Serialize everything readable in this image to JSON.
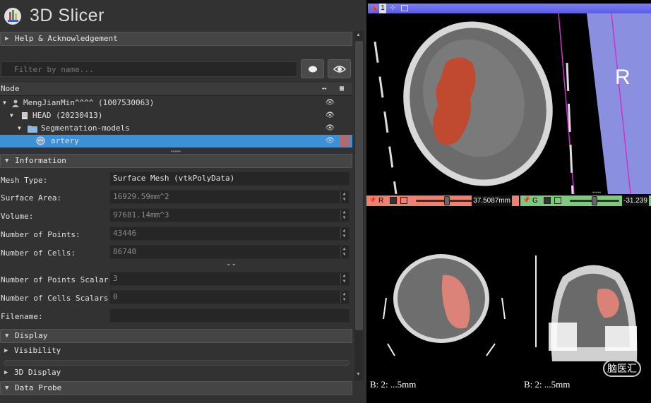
{
  "app": {
    "title": "3D Slicer",
    "logo_icon": "slicer-logo-icon"
  },
  "sections": {
    "help": "Help & Acknowledgement",
    "information": "Information",
    "display": "Display",
    "visibility": "Visibility",
    "display3d": "3D Display",
    "data_probe": "Data Probe"
  },
  "filter": {
    "placeholder": "Filter by name..."
  },
  "tree": {
    "header_node": "Node",
    "rows": [
      {
        "label": "MengJianMin^^^^ (1007530063)",
        "icon": "patient-icon"
      },
      {
        "label": "HEAD (20230413)",
        "icon": "study-icon"
      },
      {
        "label": "Segmentation-models",
        "icon": "folder-icon"
      },
      {
        "label": "artery",
        "icon": "model-icon",
        "color": "#b06a70"
      }
    ]
  },
  "info": {
    "mesh_type": {
      "label": "Mesh Type:",
      "value": "Surface Mesh (vtkPolyData)"
    },
    "surface_area": {
      "label": "Surface Area:",
      "value": "16929.59mm^2"
    },
    "volume": {
      "label": "Volume:",
      "value": "97681.14mm^3"
    },
    "num_points": {
      "label": "Number of Points:",
      "value": "43446"
    },
    "num_cells": {
      "label": "Number of Cells:",
      "value": "86740"
    },
    "num_point_scalars": {
      "label": "Number of Points Scalars:",
      "value": "3"
    },
    "num_cell_scalars": {
      "label": "Number of Cells Scalars:",
      "value": "0"
    },
    "filename": {
      "label": "Filename:",
      "value": ""
    }
  },
  "views": {
    "view3d": {
      "number": "1",
      "orientation_label": "R",
      "accent": "#6366ee"
    },
    "red": {
      "letter": "R",
      "offset": "37.5087mm",
      "slider_position": 0.55,
      "corner_text": "B: 2: ...5mm",
      "color": "#f08070"
    },
    "green": {
      "letter": "G",
      "offset": "-31.239",
      "slider_position": 0.5,
      "corner_text": "B: 2: ...5mm",
      "color": "#7fc97f"
    }
  },
  "watermark": {
    "text": "脑医汇"
  }
}
